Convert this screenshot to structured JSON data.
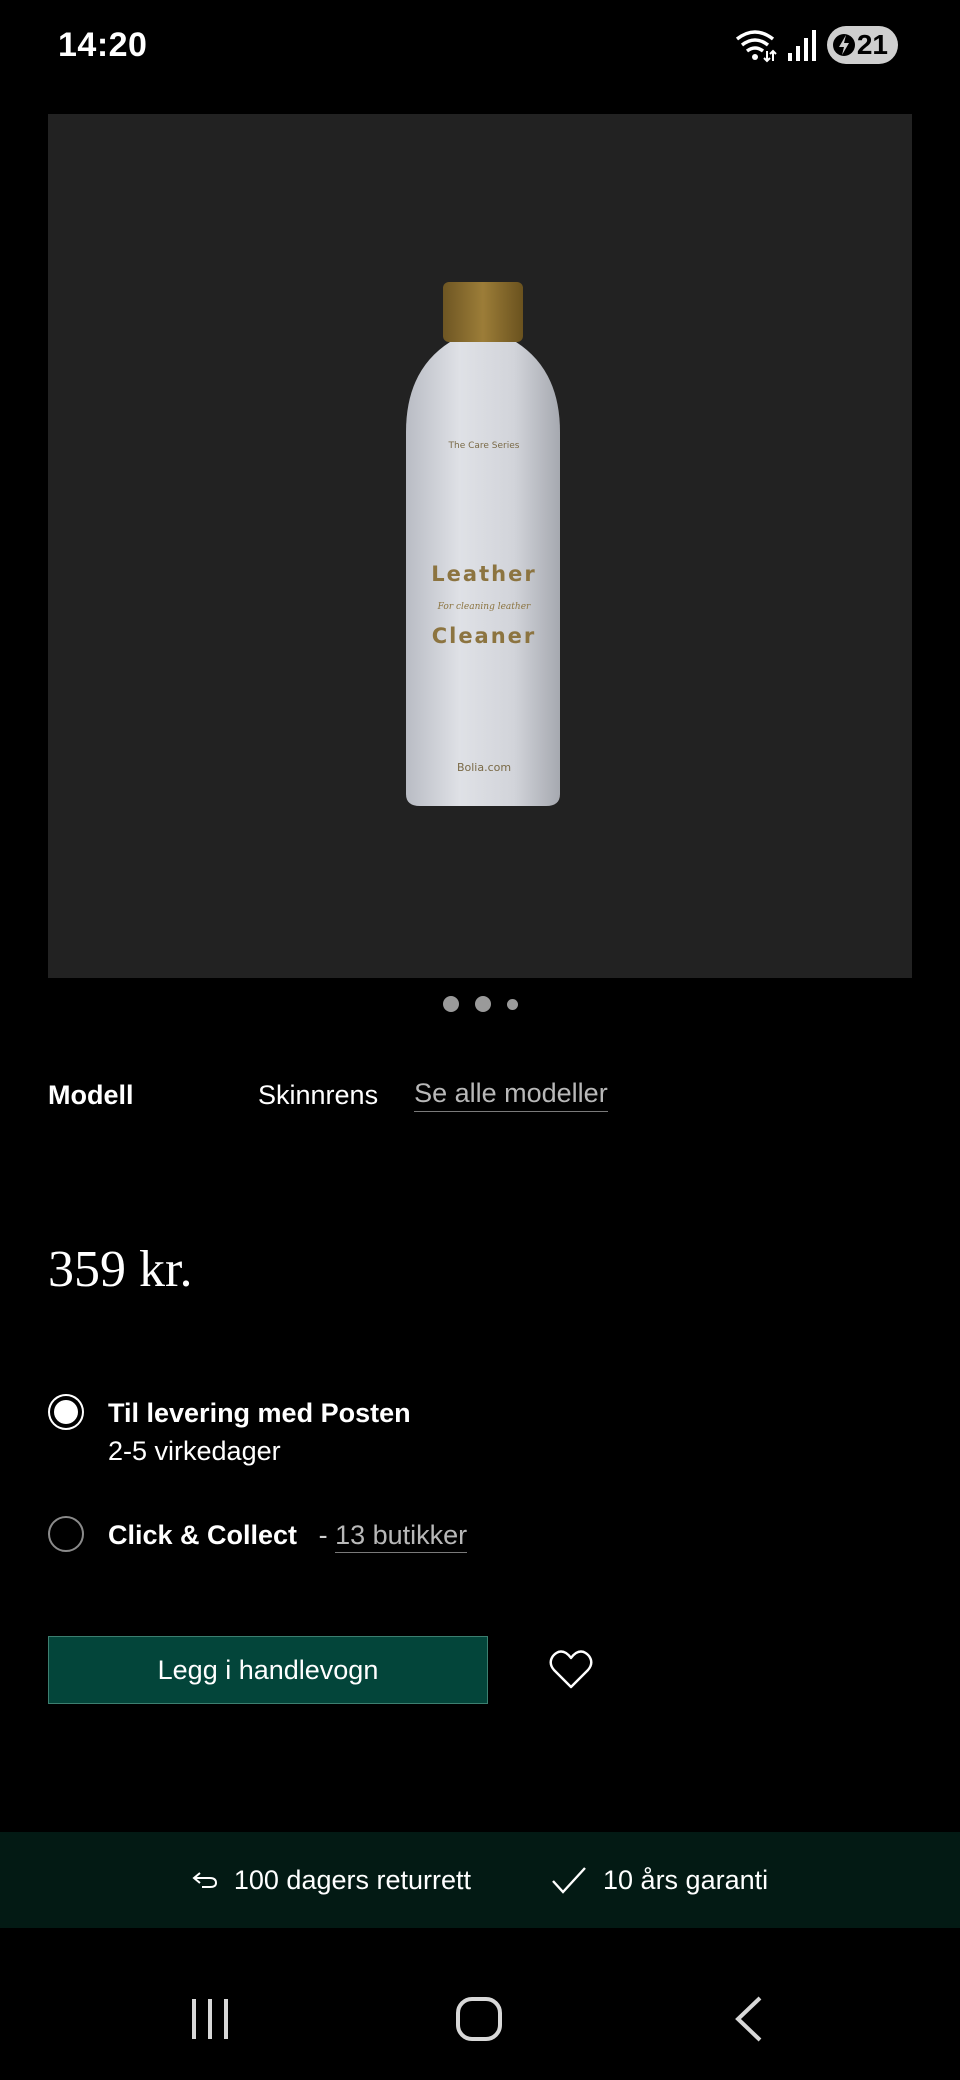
{
  "status_bar": {
    "time": "14:20",
    "battery": "21",
    "icons": [
      "wifi-icon",
      "signal-icon",
      "battery-icon"
    ]
  },
  "product": {
    "image_alt": "Leather Cleaner",
    "carousel_dots": 3
  },
  "model": {
    "label": "Modell",
    "value": "Skinnrens",
    "link": "Se alle modeller"
  },
  "price": "359 kr.",
  "delivery": {
    "option1_title": "Til levering med Posten",
    "option1_sub": "2-5 virkedager",
    "option2_title": "Click & Collect",
    "option2_prefix": "-",
    "option2_link": "13 butikker"
  },
  "cart": {
    "button_label": "Legg i handlevogn"
  },
  "benefits": {
    "returns": "100 dagers returrett",
    "warranty": "10 års garanti"
  },
  "colors": {
    "primary_button": "#03453a",
    "benefits_bg": "#031a14"
  }
}
